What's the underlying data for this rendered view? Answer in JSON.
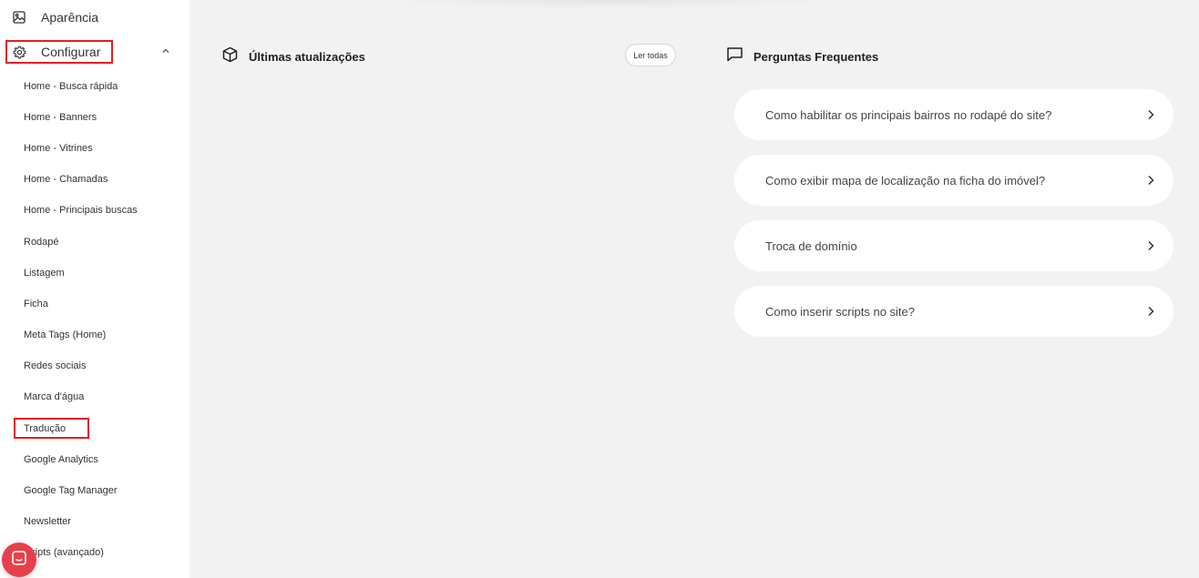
{
  "sidebar": {
    "appearance_label": "Aparência",
    "configure_label": "Configurar",
    "configure_items": [
      "Home - Busca rápida",
      "Home - Banners",
      "Home - Vitrines",
      "Home - Chamadas",
      "Home - Principais buscas",
      "Rodapé",
      "Listagem",
      "Ficha",
      "Meta Tags (Home)",
      "Redes sociais",
      "Marca d'água",
      "Tradução",
      "Google Analytics",
      "Google Tag Manager",
      "Newsletter",
      "ripts (avançado)"
    ]
  },
  "updates": {
    "title": "Últimas atualizações",
    "read_all_label": "Ler todas"
  },
  "faq": {
    "title": "Perguntas Frequentes",
    "questions": [
      "Como habilitar os principais bairros no rodapé do site?",
      "Como exibir mapa de localização na ficha do imóvel?",
      "Troca de domínio",
      "Como inserir scripts no site?"
    ]
  },
  "colors": {
    "highlight": "#e02020",
    "chat_launcher": "#e8404a",
    "background": "#f2f2f2",
    "card": "#ffffff"
  },
  "icons": {
    "appearance": "image-icon",
    "configure": "gear-icon",
    "updates": "cube-icon",
    "faq": "chat-bubble-icon",
    "chat_launcher": "chat-icon"
  }
}
